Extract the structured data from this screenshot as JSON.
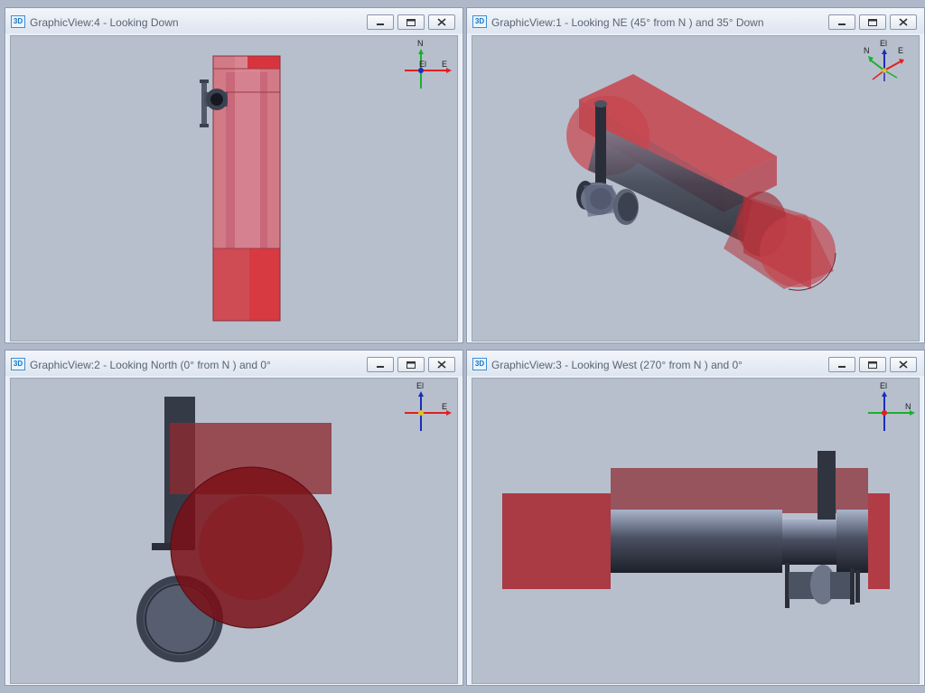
{
  "views": [
    {
      "id": "view4",
      "icon_label": "3D",
      "title": "GraphicView:4 - Looking Down",
      "triad_labels": {
        "up": "N",
        "right": "E",
        "center": "El"
      }
    },
    {
      "id": "view1",
      "icon_label": "3D",
      "title": "GraphicView:1 - Looking NE (45° from N ) and 35° Down",
      "triad_labels": {
        "up": "El",
        "right": "E",
        "left": "N"
      }
    },
    {
      "id": "view2",
      "icon_label": "3D",
      "title": "GraphicView:2 - Looking North (0° from N ) and 0°",
      "triad_labels": {
        "up": "El",
        "right": "E"
      }
    },
    {
      "id": "view3",
      "icon_label": "3D",
      "title": "GraphicView:3 - Looking West (270° from N ) and 0°",
      "triad_labels": {
        "up": "El",
        "right": "N"
      }
    }
  ],
  "window_buttons": [
    "minimize-icon",
    "maximize-icon",
    "close-icon"
  ],
  "colors": {
    "viewport_bg": "#b7bfcd",
    "equipment_red": "#b0141c",
    "pipe_dark": "#3c4150",
    "axis_red": "#e02020",
    "axis_green": "#17b12c",
    "axis_blue": "#1c2db8"
  }
}
